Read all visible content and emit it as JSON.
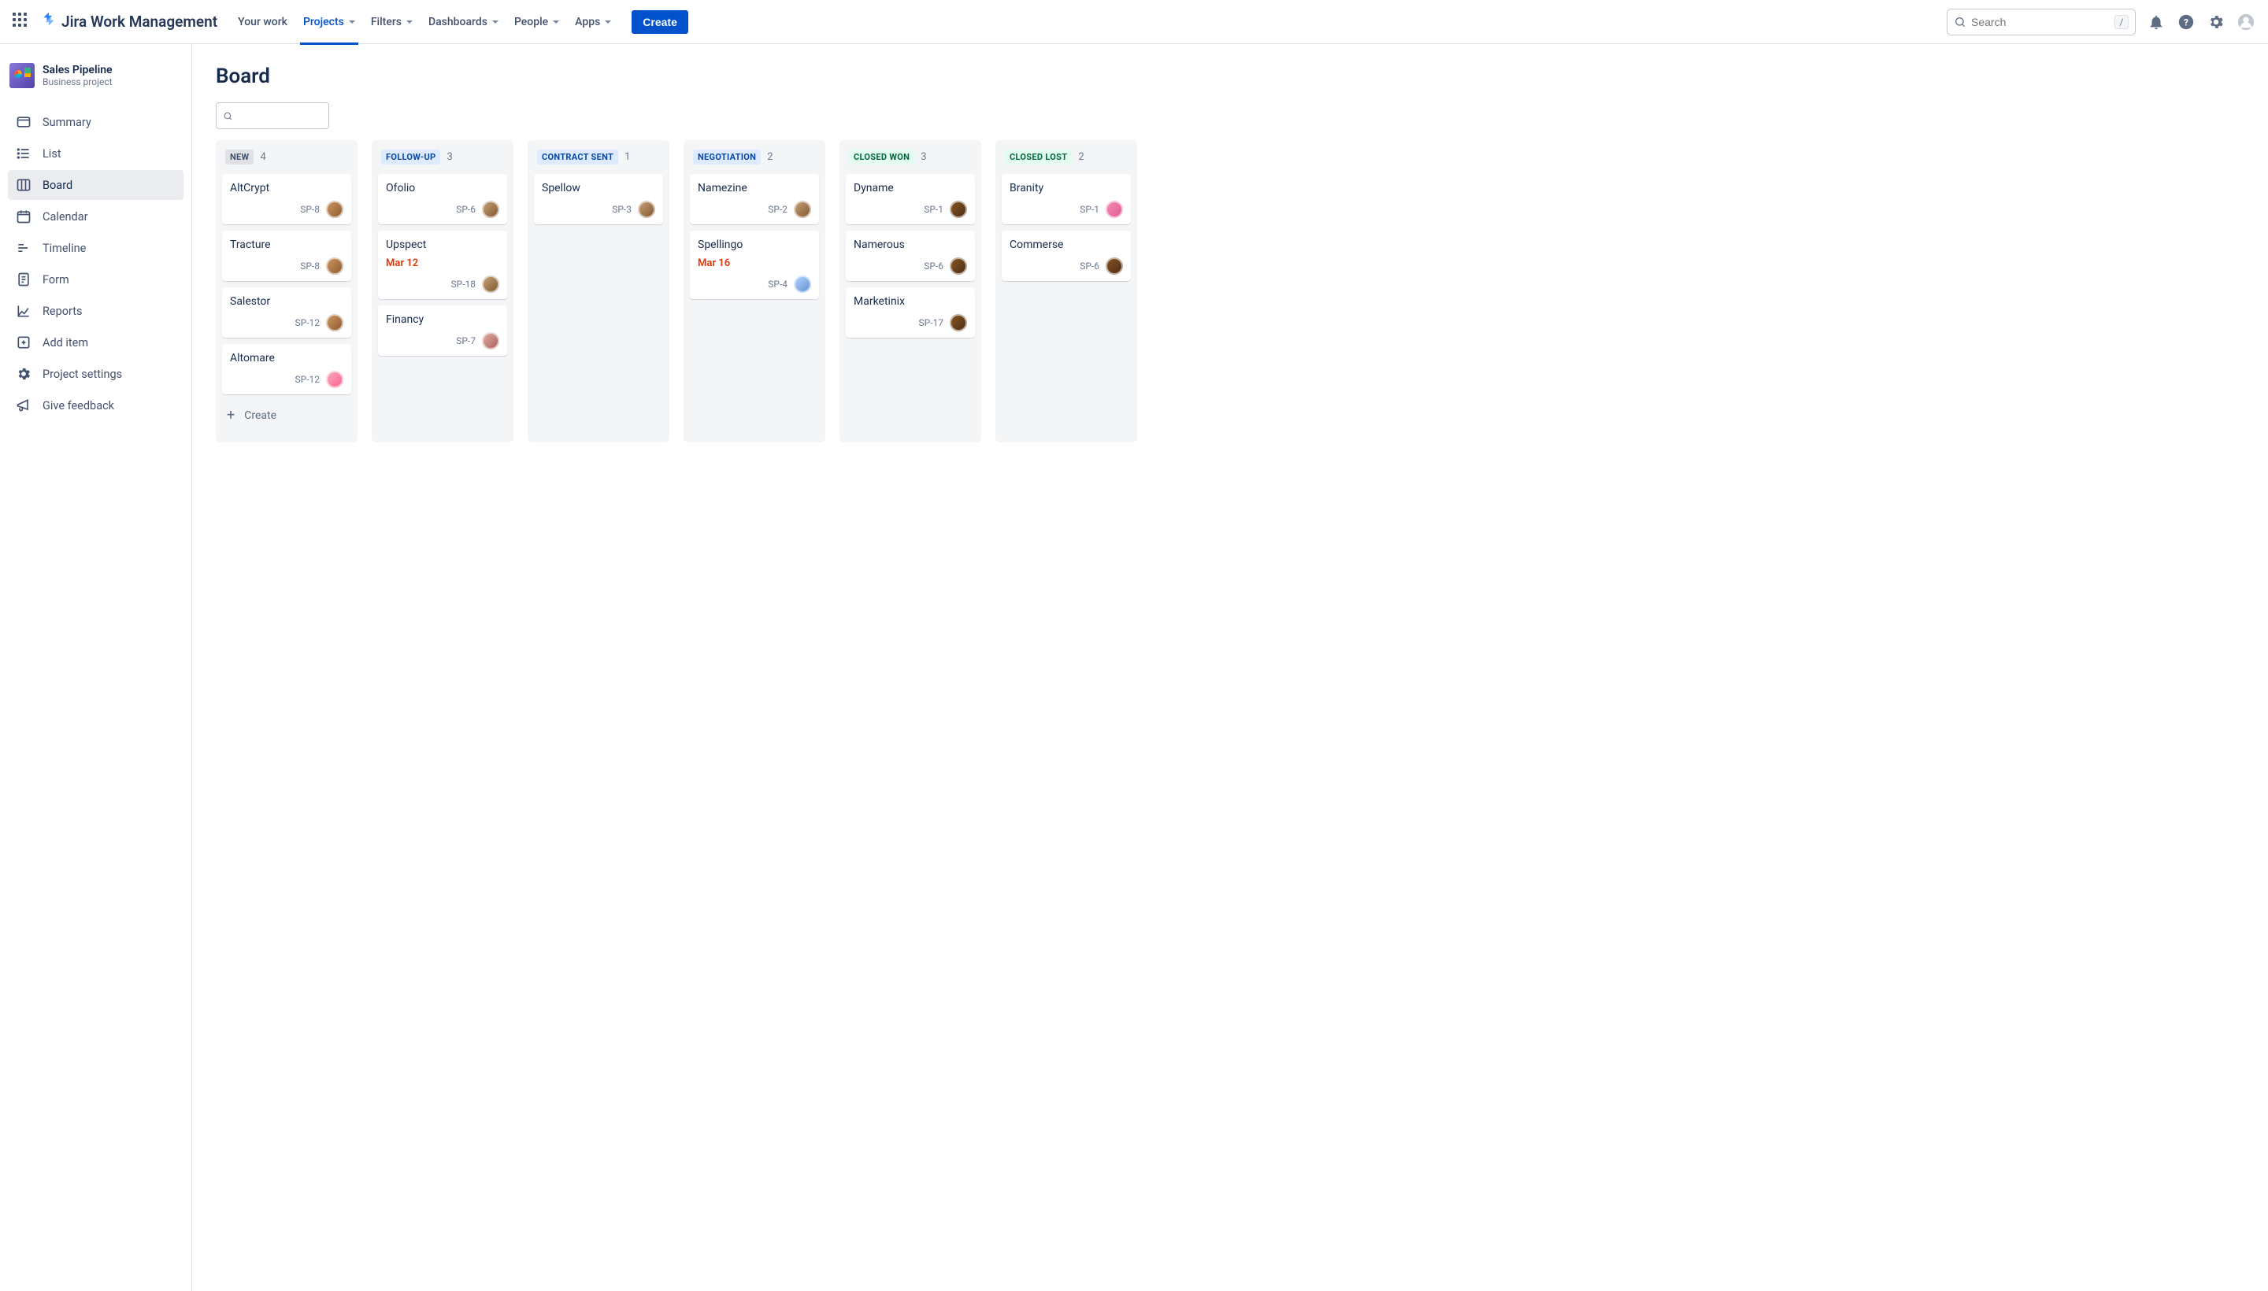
{
  "header": {
    "product_name": "Jira Work Management",
    "nav": {
      "your_work": "Your work",
      "projects": "Projects",
      "filters": "Filters",
      "dashboards": "Dashboards",
      "people": "People",
      "apps": "Apps"
    },
    "create_label": "Create",
    "search_placeholder": "Search",
    "slash_hint": "/"
  },
  "sidebar": {
    "project_name": "Sales Pipeline",
    "project_type": "Business project",
    "items": [
      {
        "label": "Summary"
      },
      {
        "label": "List"
      },
      {
        "label": "Board"
      },
      {
        "label": "Calendar"
      },
      {
        "label": "Timeline"
      },
      {
        "label": "Form"
      },
      {
        "label": "Reports"
      },
      {
        "label": "Add item"
      },
      {
        "label": "Project settings"
      },
      {
        "label": "Give feedback"
      }
    ]
  },
  "board": {
    "title": "Board",
    "create_label": "Create",
    "columns": [
      {
        "name": "NEW",
        "count": 4,
        "style_class": "tag-new",
        "cards": [
          {
            "title": "AltCrypt",
            "key": "SP-8",
            "avatar": "linear-gradient(135deg,#d19a66,#8b572a)"
          },
          {
            "title": "Tracture",
            "key": "SP-8",
            "avatar": "linear-gradient(135deg,#d19a66,#8b572a)"
          },
          {
            "title": "Salestor",
            "key": "SP-12",
            "avatar": "linear-gradient(135deg,#d19a66,#8b572a)"
          },
          {
            "title": "Altomare",
            "key": "SP-12",
            "avatar": "linear-gradient(135deg,#f8b0c1,#ff5c8a)"
          }
        ]
      },
      {
        "name": "FOLLOW-UP",
        "count": 3,
        "style_class": "tag-followup",
        "cards": [
          {
            "title": "Ofolio",
            "key": "SP-6",
            "avatar": "linear-gradient(135deg,#cfa97d,#7a4f2a)"
          },
          {
            "title": "Upspect",
            "date": "Mar 12",
            "key": "SP-18",
            "avatar": "linear-gradient(135deg,#cfa97d,#7a4f2a)"
          },
          {
            "title": "Financy",
            "key": "SP-7",
            "avatar": "linear-gradient(135deg,#e7b4ab,#a35a52)"
          }
        ]
      },
      {
        "name": "CONTRACT SENT",
        "count": 1,
        "style_class": "tag-contract",
        "cards": [
          {
            "title": "Spellow",
            "key": "SP-3",
            "avatar": "linear-gradient(135deg,#cfa97d,#7a4f2a)"
          }
        ]
      },
      {
        "name": "NEGOTIATION",
        "count": 2,
        "style_class": "tag-negotiation",
        "cards": [
          {
            "title": "Namezine",
            "key": "SP-2",
            "avatar": "linear-gradient(135deg,#cfa97d,#7a4f2a)"
          },
          {
            "title": "Spellingo",
            "date": "Mar 16",
            "key": "SP-4",
            "avatar": "linear-gradient(135deg,#bcd9ff,#5a8cd1)"
          }
        ]
      },
      {
        "name": "CLOSED WON",
        "count": 3,
        "style_class": "tag-won",
        "cards": [
          {
            "title": "Dyname",
            "key": "SP-1",
            "avatar": "linear-gradient(135deg,#8b572a,#4a2a10)"
          },
          {
            "title": "Namerous",
            "key": "SP-6",
            "avatar": "linear-gradient(135deg,#8b572a,#4a2a10)"
          },
          {
            "title": "Marketinix",
            "key": "SP-17",
            "avatar": "linear-gradient(135deg,#8b572a,#4a2a10)"
          }
        ]
      },
      {
        "name": "CLOSED LOST",
        "count": 2,
        "style_class": "tag-lost",
        "cards": [
          {
            "title": "Branity",
            "key": "SP-1",
            "avatar": "linear-gradient(135deg,#f78fb3,#e05593)"
          },
          {
            "title": "Commerse",
            "key": "SP-6",
            "avatar": "linear-gradient(135deg,#8b572a,#4a2a10)"
          }
        ]
      }
    ]
  }
}
